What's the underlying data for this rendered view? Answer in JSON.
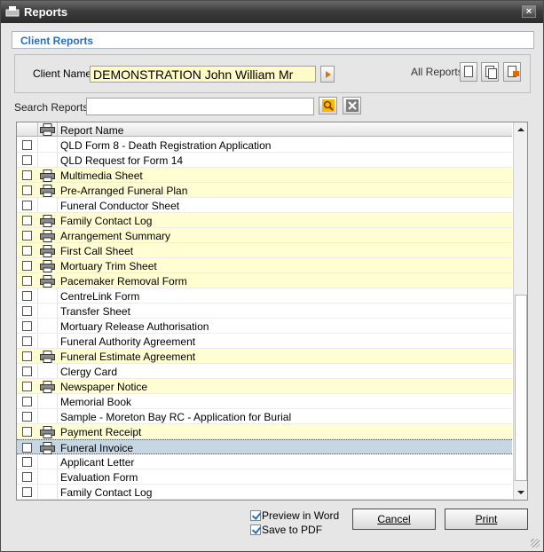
{
  "window": {
    "title": "Reports",
    "close_glyph": "×"
  },
  "header": {
    "title": "Client Reports"
  },
  "client": {
    "label": "Client Name:",
    "value": "DEMONSTRATION John William Mr",
    "all_reports_label": "All Reports"
  },
  "search": {
    "label": "Search Reports:",
    "value": ""
  },
  "grid": {
    "column_header": "Report Name",
    "rows": [
      {
        "name": "QLD Form 8 - Death Registration Application",
        "printable": false,
        "selected": false
      },
      {
        "name": "QLD Request for Form 14",
        "printable": false,
        "selected": false
      },
      {
        "name": "Multimedia Sheet",
        "printable": true,
        "selected": false
      },
      {
        "name": "Pre-Arranged Funeral Plan",
        "printable": true,
        "selected": false
      },
      {
        "name": "Funeral Conductor Sheet",
        "printable": false,
        "selected": false
      },
      {
        "name": "Family Contact Log",
        "printable": true,
        "selected": false
      },
      {
        "name": "Arrangement Summary",
        "printable": true,
        "selected": false
      },
      {
        "name": "First Call Sheet",
        "printable": true,
        "selected": false
      },
      {
        "name": "Mortuary Trim Sheet",
        "printable": true,
        "selected": false
      },
      {
        "name": "Pacemaker Removal Form",
        "printable": true,
        "selected": false
      },
      {
        "name": "CentreLink Form",
        "printable": false,
        "selected": false
      },
      {
        "name": "Transfer Sheet",
        "printable": false,
        "selected": false
      },
      {
        "name": "Mortuary Release Authorisation",
        "printable": false,
        "selected": false
      },
      {
        "name": "Funeral Authority Agreement",
        "printable": false,
        "selected": false
      },
      {
        "name": "Funeral Estimate Agreement",
        "printable": true,
        "selected": false
      },
      {
        "name": "Clergy Card",
        "printable": false,
        "selected": false
      },
      {
        "name": "Newspaper Notice",
        "printable": true,
        "selected": false
      },
      {
        "name": "Memorial Book",
        "printable": false,
        "selected": false
      },
      {
        "name": "Sample - Moreton Bay RC - Application for Burial",
        "printable": false,
        "selected": false
      },
      {
        "name": "Payment Receipt",
        "printable": true,
        "selected": false
      },
      {
        "name": "Funeral Invoice",
        "printable": true,
        "selected": true
      },
      {
        "name": "Applicant Letter",
        "printable": false,
        "selected": false
      },
      {
        "name": "Evaluation Form",
        "printable": false,
        "selected": false
      },
      {
        "name": "Family Contact Log",
        "printable": false,
        "selected": false
      }
    ]
  },
  "options": {
    "preview_word": "Preview in Word",
    "save_pdf": "Save to PDF"
  },
  "buttons": {
    "cancel": "Cancel",
    "print": "Print"
  },
  "colors": {
    "printable_row": "#fffdd2",
    "selected_row": "#c7d6e3",
    "header_title": "#2a6ebb",
    "client_field_bg": "#fffbc6"
  },
  "icons": [
    "reports-app-icon",
    "close-icon",
    "arrow-right-icon",
    "single-doc-icon",
    "multi-doc-icon",
    "export-doc-icon",
    "search-icon",
    "clear-icon",
    "printer-icon"
  ]
}
